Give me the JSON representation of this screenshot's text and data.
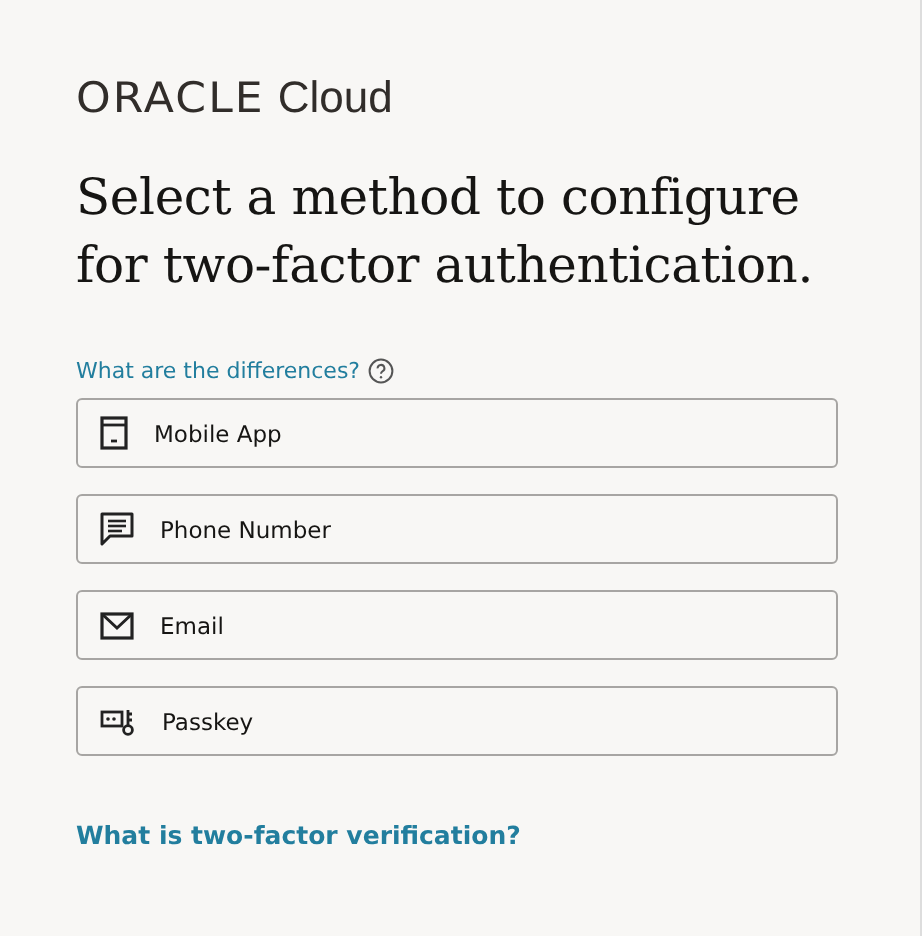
{
  "logo": {
    "brand": "ORACLE",
    "product": "Cloud"
  },
  "heading": "Select a method to configure for two-factor authentication.",
  "differences_link": "What are the differences?",
  "methods": [
    {
      "kind": "mobile",
      "label": "Mobile App"
    },
    {
      "kind": "sms",
      "label": "Phone Number"
    },
    {
      "kind": "email",
      "label": "Email"
    },
    {
      "kind": "passkey",
      "label": "Passkey"
    }
  ],
  "footer_link": "What is two-factor verification?"
}
